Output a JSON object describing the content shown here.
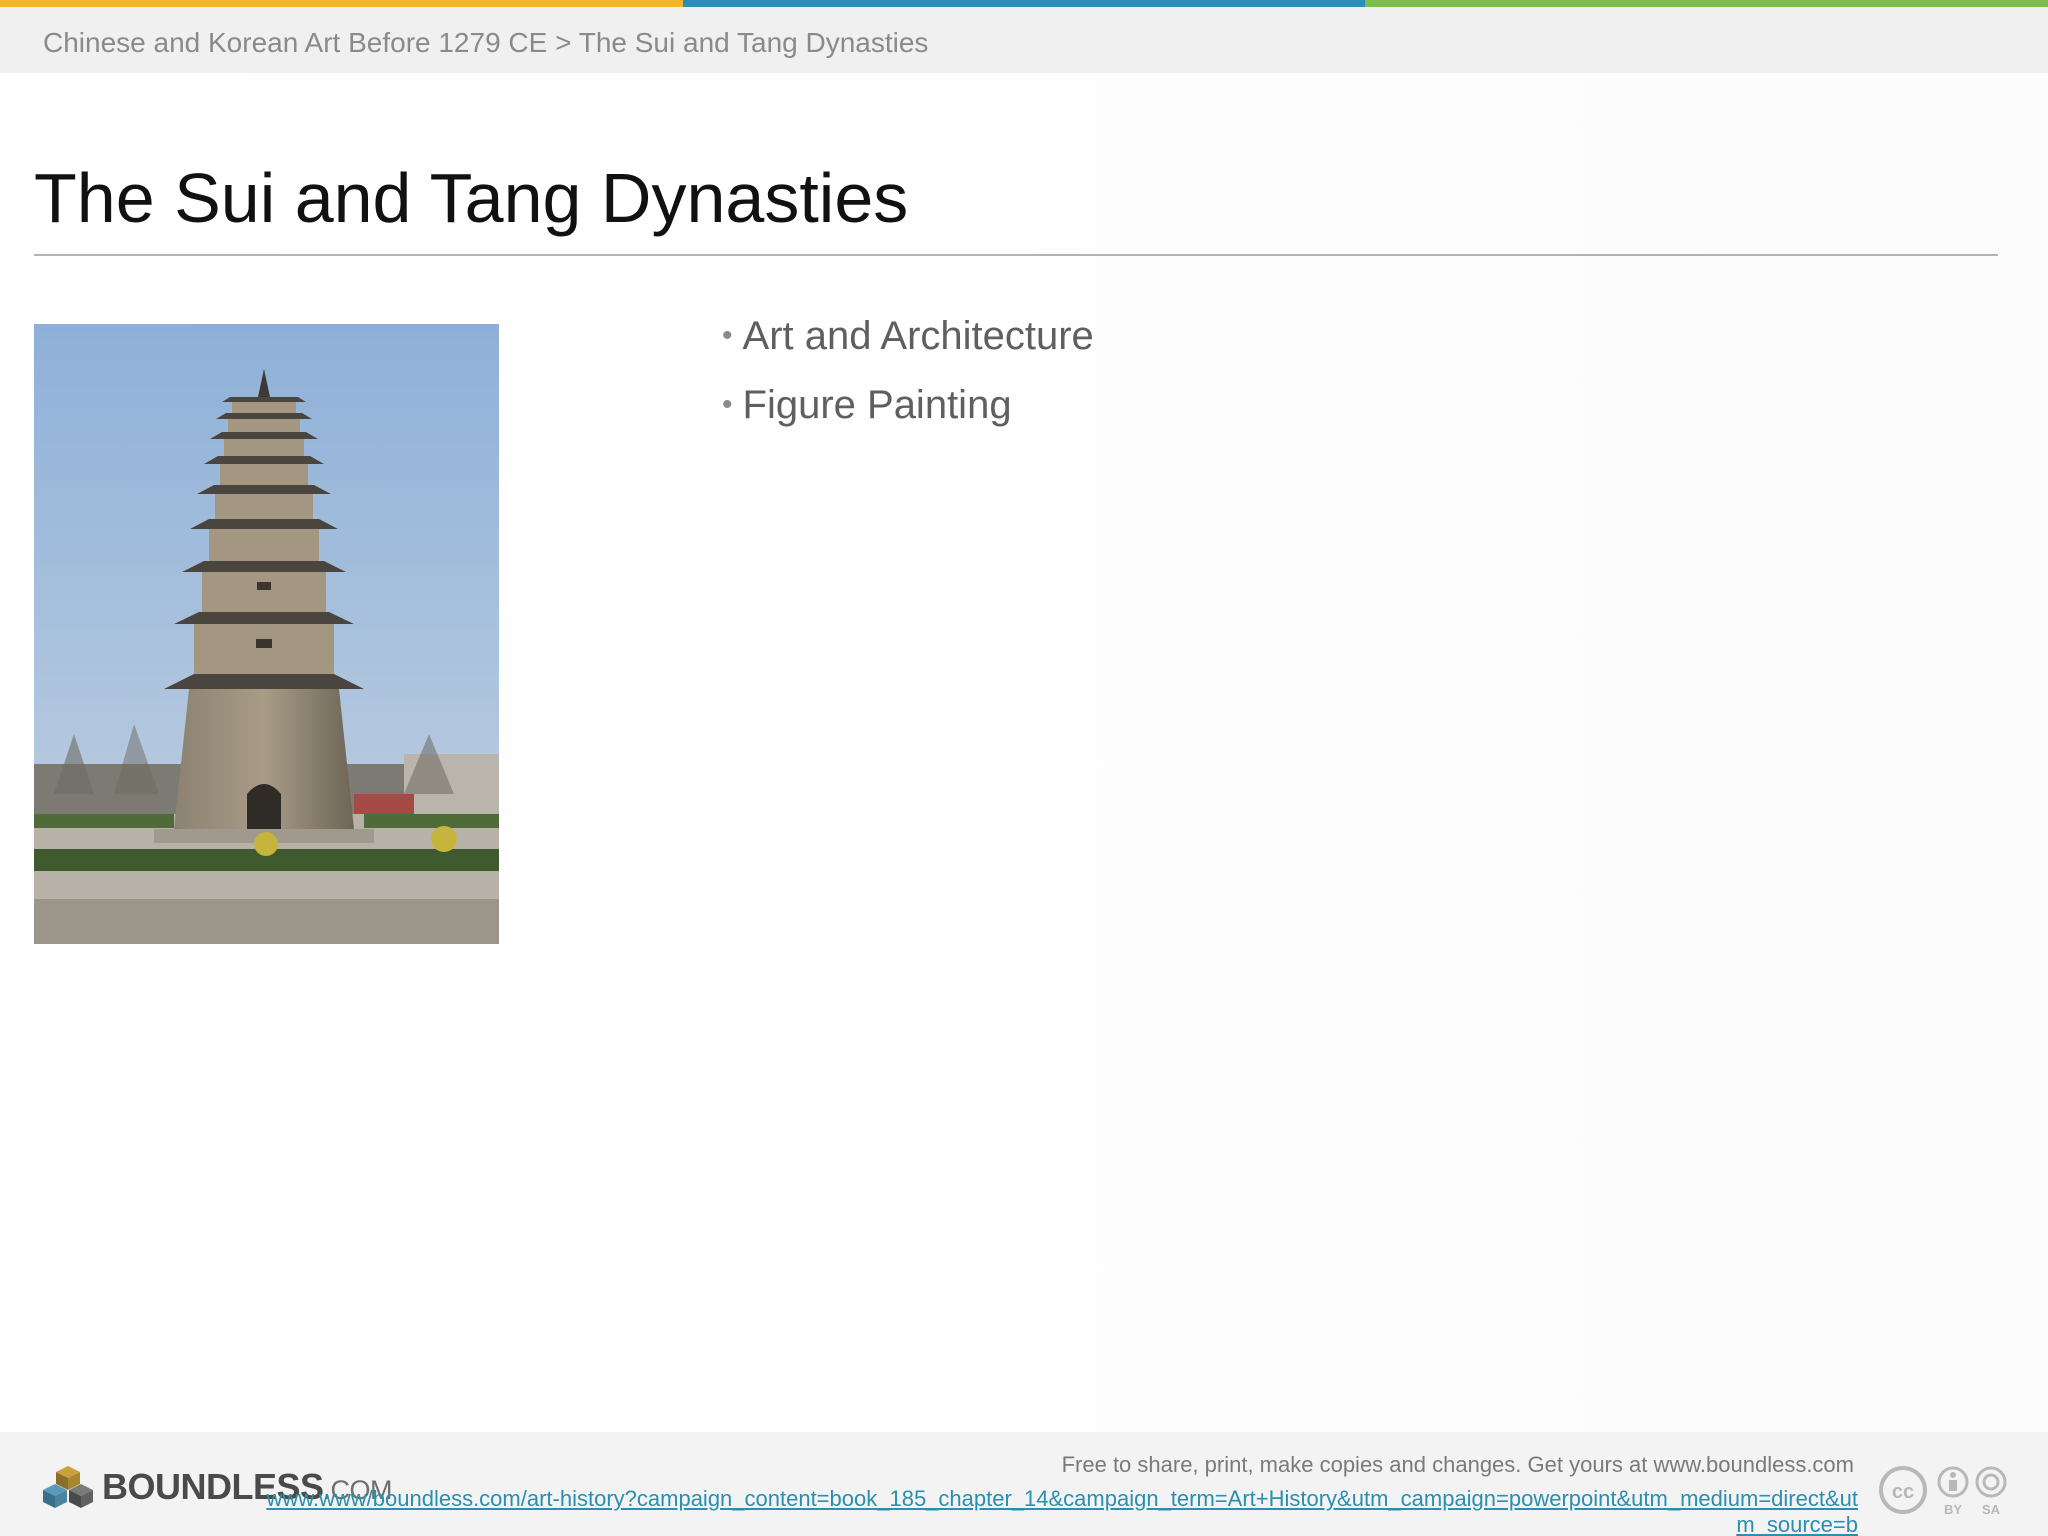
{
  "colors": {
    "strip": [
      "#f7b528",
      "#2a8fb8",
      "#7cbd4b"
    ],
    "link": "#2a8fb0"
  },
  "breadcrumb": "Chinese and Korean Art Before 1279 CE > The Sui and Tang Dynasties",
  "slide": {
    "title": "The Sui and Tang Dynasties",
    "image_subject": "brick pagoda",
    "bullets": [
      "Art and Architecture",
      "Figure Painting"
    ]
  },
  "footer": {
    "logo_text": "BOUNDLESS",
    "logo_suffix": ".COM",
    "note": "Free to share, print, make copies and changes. Get yours at www.boundless.com",
    "link": "www.www/boundless.com/art-history?campaign_content=book_185_chapter_14&campaign_term=Art+History&utm_campaign=powerpoint&utm_medium=direct&utm_source=b",
    "license_labels": [
      "BY",
      "SA"
    ],
    "icons": [
      "cc-icon",
      "by-icon",
      "sa-icon"
    ]
  }
}
